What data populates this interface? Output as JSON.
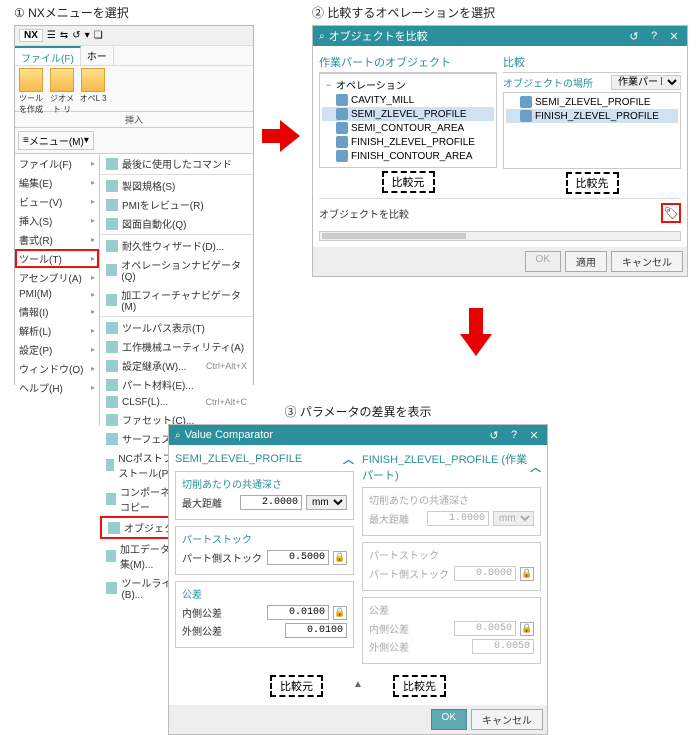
{
  "captions": {
    "step1": "① NXメニューを選択",
    "step2": "② 比較するオペレーションを選択",
    "step3": "③ パラメータの差異を表示"
  },
  "badges": {
    "source": "比較元",
    "target": "比較先"
  },
  "nx": {
    "logo": "NX",
    "top_icons": [
      "☰",
      "⇆",
      "↺",
      "▾",
      "❏",
      "▾"
    ],
    "tab_file": "ファイル(F)",
    "tab_home": "ホー",
    "ribbon": [
      {
        "label": "ツールを作成"
      },
      {
        "label": "ジオメト\nリ"
      },
      {
        "label": "オペL\n3"
      }
    ],
    "ribbon_group_label": "挿入",
    "menu_button": "メニュー(M)",
    "left_menu": [
      "ファイル(F)",
      "編集(E)",
      "ビュー(V)",
      "挿入(S)",
      "書式(R)",
      "ツール(T)",
      "アセンブリ(A)",
      "PMI(M)",
      "情報(I)",
      "解析(L)",
      "設定(P)",
      "ウィンドウ(O)",
      "ヘルプ(H)"
    ],
    "right_menu": [
      {
        "t": "item",
        "label": "最後に使用したコマンド"
      },
      {
        "t": "sep"
      },
      {
        "t": "item",
        "label": "製図規格(S)"
      },
      {
        "t": "item",
        "label": "PMIをレビュー(R)"
      },
      {
        "t": "item",
        "label": "図面自動化(Q)"
      },
      {
        "t": "sep"
      },
      {
        "t": "item",
        "label": "耐久性ウィザード(D)..."
      },
      {
        "t": "item",
        "label": "オペレーションナビゲータ(Q)"
      },
      {
        "t": "item",
        "label": "加工フィーチャナビゲータ(M)"
      },
      {
        "t": "sep"
      },
      {
        "t": "item",
        "label": "ツールパス表示(T)"
      },
      {
        "t": "item",
        "label": "工作機械ユーティリティ(A)"
      },
      {
        "t": "item",
        "label": "設定継承(W)...",
        "sc": "Ctrl+Alt+X"
      },
      {
        "t": "item",
        "label": "パート材料(E)..."
      },
      {
        "t": "item",
        "label": "CLSF(L)...",
        "sc": "Ctrl+Alt+C"
      },
      {
        "t": "item",
        "label": "ファセット(C)..."
      },
      {
        "t": "item",
        "label": "サーフェス領域(V)..."
      },
      {
        "t": "item",
        "label": "NCポストプロセッサをインストール(P)..."
      },
      {
        "t": "item",
        "label": "コンポーネントからCAMをコピー"
      },
      {
        "t": "item",
        "label": "オブジェクトを比較...",
        "hi": true
      },
      {
        "t": "item",
        "label": "加工データライブラリを編集(M)..."
      },
      {
        "t": "item",
        "label": "ツールライブラリを変換(B)..."
      }
    ]
  },
  "compare": {
    "title": "オブジェクトを比較",
    "h_work": "作業パートのオブジェクト",
    "h_cmp": "比較",
    "loc_label": "オブジェクトの場所",
    "loc_value": "作業パート",
    "group_label": "オペレーション",
    "left_items": [
      "CAVITY_MILL",
      "SEMI_ZLEVEL_PROFILE",
      "SEMI_CONTOUR_AREA",
      "FINISH_ZLEVEL_PROFILE",
      "FINISH_CONTOUR_AREA"
    ],
    "left_sel": 1,
    "right_items": [
      "SEMI_ZLEVEL_PROFILE",
      "FINISH_ZLEVEL_PROFILE"
    ],
    "right_sel": 1,
    "exec_label": "オブジェクトを比較",
    "ok": "OK",
    "apply": "適用",
    "cancel": "キャンセル"
  },
  "vc": {
    "title": "Value Comparator",
    "left_name": "SEMI_ZLEVEL_PROFILE",
    "right_name": "FINISH_ZLEVEL_PROFILE (作業パート)",
    "groups": {
      "cut_depth": {
        "h": "切削あたりの共通深さ",
        "row": "最大距離",
        "unit": "mm",
        "left": "2.0000",
        "right": "1.0000"
      },
      "part_stock": {
        "h": "パートストック",
        "row": "パート側ストック",
        "left": "0.5000",
        "right": "0.0000"
      },
      "tol": {
        "h": "公差",
        "row1": "内側公差",
        "row2": "外側公差",
        "left1": "0.0100",
        "left2": "0.0100",
        "right1": "0.0050",
        "right2": "0.0050"
      }
    },
    "ok": "OK",
    "cancel": "キャンセル"
  }
}
